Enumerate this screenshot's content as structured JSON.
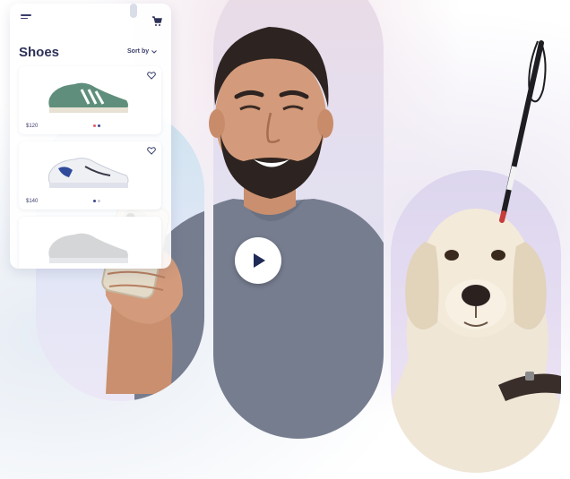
{
  "app": {
    "title": "Shoes",
    "sort_label": "Sort by",
    "products": [
      {
        "price": "$120",
        "color_dots": [
          "#e45b6a",
          "#3c4a8a"
        ]
      },
      {
        "price": "$140",
        "color_dots": [
          "#3c4a8a",
          "#c9ccd8"
        ]
      },
      {
        "price": "",
        "color_dots": []
      }
    ]
  },
  "video": {
    "play_icon": "play-icon"
  },
  "icons": {
    "menu": "menu-icon",
    "cart": "cart-icon",
    "heart": "heart-icon",
    "chevron": "chevron-down-icon"
  },
  "colors": {
    "accent_dark": "#2d3158",
    "play_triangle": "#1f2a56"
  }
}
